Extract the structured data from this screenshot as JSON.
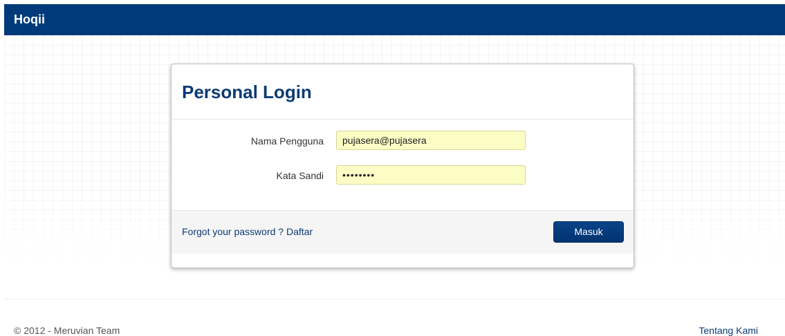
{
  "app": {
    "brand": "Hoqii"
  },
  "login": {
    "title": "Personal Login",
    "username_label": "Nama Pengguna",
    "username_value": "pujasera@pujasera",
    "password_label": "Kata Sandi",
    "password_value": "••••••••",
    "forgot_link": "Forgot your password ?",
    "register_link": "Daftar",
    "submit_label": "Masuk"
  },
  "footer": {
    "copyright": "© 2012 - Meruvian Team",
    "about_link": "Tentang Kami"
  },
  "colors": {
    "navbar": "#003a7a",
    "title": "#0c3b73",
    "input_autofill": "#fcfdc4",
    "button": "#0a4488"
  }
}
